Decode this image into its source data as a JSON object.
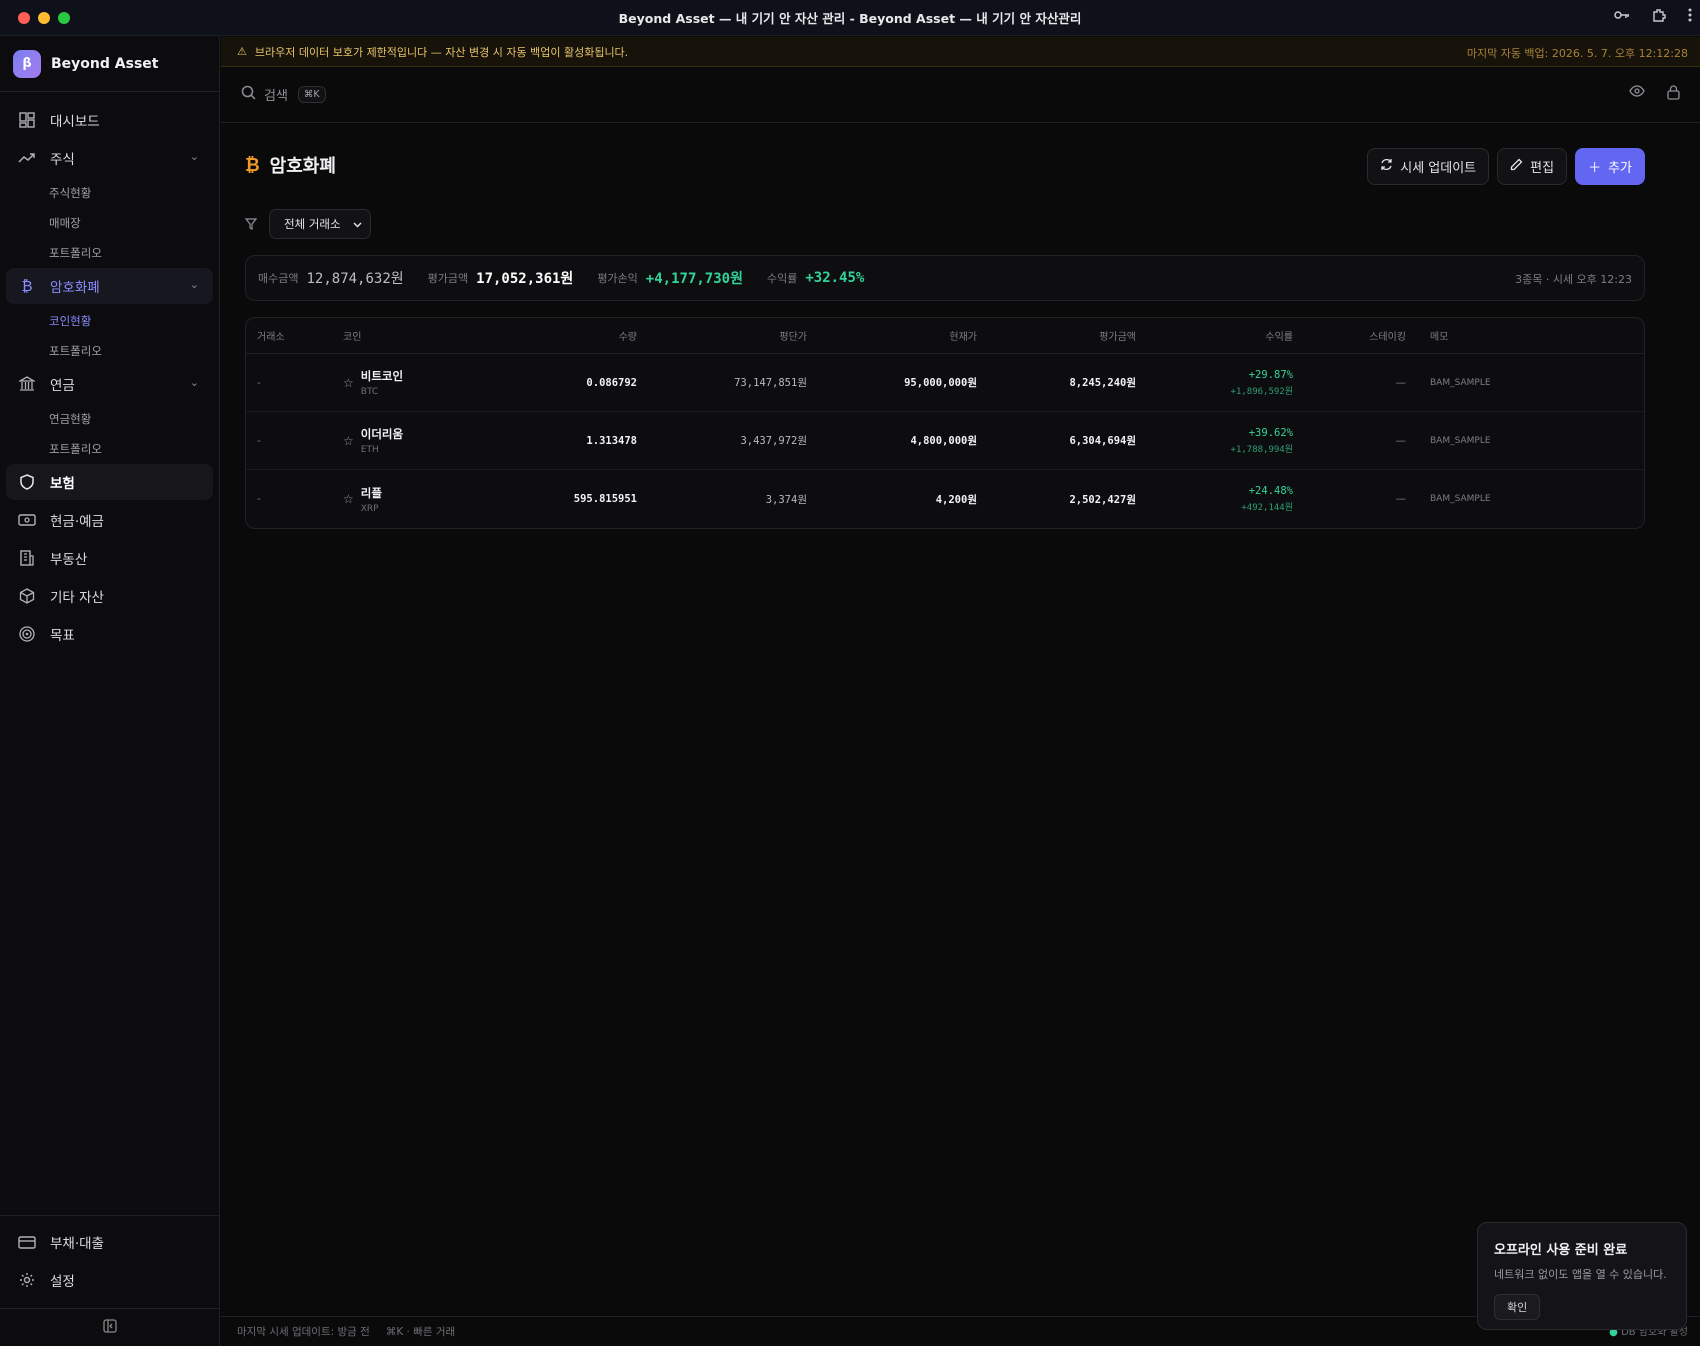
{
  "window": {
    "title": "Beyond Asset — 내 기기 안 자산 관리 - Beyond Asset — 내 기기 안 자산관리",
    "colors": {
      "close": "#ff5f57",
      "minimize": "#febc2e",
      "maximize": "#28c840"
    }
  },
  "brand": {
    "logo": "β",
    "name": "Beyond Asset"
  },
  "nav": {
    "dashboard": "대시보드",
    "stocks": "주식",
    "stocks_sub": [
      "주식현황",
      "매매장",
      "포트폴리오"
    ],
    "crypto": "암호화폐",
    "crypto_sub": [
      "코인현황",
      "포트폴리오"
    ],
    "pension": "연금",
    "pension_sub": [
      "연금현황",
      "포트폴리오"
    ],
    "insurance": "보험",
    "cash": "현금·예금",
    "realestate": "부동산",
    "other": "기타 자산",
    "goal": "목표",
    "debt": "부채·대출",
    "settings": "설정"
  },
  "banner": {
    "text": "브라우저 데이터 보호가 제한적입니다 — 자산 변경 시 자동 백업이 활성화됩니다.",
    "backup": "마지막 자동 백업: 2026. 5. 7. 오후 12:12:28"
  },
  "search": {
    "label": "검색",
    "shortcut": "⌘K"
  },
  "page": {
    "title": "암호화폐",
    "btn_update": "시세 업데이트",
    "btn_edit": "편집",
    "btn_add": "추가",
    "exchange_filter": "전체 거래소"
  },
  "summary": {
    "buy_label": "매수금액",
    "buy_value": "12,874,632원",
    "eval_label": "평가금액",
    "eval_value": "17,052,361원",
    "pnl_label": "평가손익",
    "pnl_value": "+4,177,730원",
    "ret_label": "수익률",
    "ret_value": "+32.45%",
    "meta": "3종목 · 시세 오후 12:23"
  },
  "table": {
    "headers": {
      "exchange": "거래소",
      "coin": "코인",
      "qty": "수량",
      "avg": "평단가",
      "cur": "현재가",
      "value": "평가금액",
      "ret": "수익률",
      "staking": "스테이킹",
      "memo": "메모"
    },
    "rows": [
      {
        "exchange": "-",
        "name": "비트코인",
        "symbol": "BTC",
        "qty": "0.086792",
        "avg": "73,147,851원",
        "cur": "95,000,000원",
        "value": "8,245,240원",
        "ret": "+29.87%",
        "pnl": "+1,896,592원",
        "staking": "—",
        "memo": "BAM_SAMPLE"
      },
      {
        "exchange": "-",
        "name": "이더리움",
        "symbol": "ETH",
        "qty": "1.313478",
        "avg": "3,437,972원",
        "cur": "4,800,000원",
        "value": "6,304,694원",
        "ret": "+39.62%",
        "pnl": "+1,788,994원",
        "staking": "—",
        "memo": "BAM_SAMPLE"
      },
      {
        "exchange": "-",
        "name": "리플",
        "symbol": "XRP",
        "qty": "595.815951",
        "avg": "3,374원",
        "cur": "4,200원",
        "value": "2,502,427원",
        "ret": "+24.48%",
        "pnl": "+492,144원",
        "staking": "—",
        "memo": "BAM_SAMPLE"
      }
    ]
  },
  "status": {
    "last_update": "마지막 시세 업데이트: 방금 전",
    "shortcut": "⌘K · 빠른 거래",
    "db": "DB 암호화 활성"
  },
  "toast": {
    "title": "오프라인 사용 준비 완료",
    "desc": "네트워크 없이도 앱을 열 수 있습니다.",
    "btn": "확인"
  }
}
